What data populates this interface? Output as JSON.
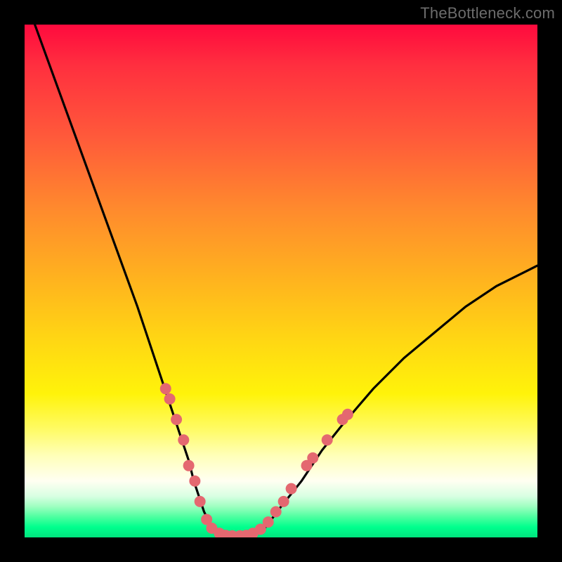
{
  "watermark": "TheBottleneck.com",
  "colors": {
    "background": "#000000",
    "curve": "#000000",
    "marker": "#e46870",
    "gradient_top": "#ff0a3e",
    "gradient_bottom": "#00e47e"
  },
  "chart_data": {
    "type": "line",
    "title": "",
    "xlabel": "",
    "ylabel": "",
    "xlim": [
      0,
      100
    ],
    "ylim": [
      0,
      100
    ],
    "series": [
      {
        "name": "bottleneck-curve",
        "x": [
          2,
          6,
          10,
          14,
          18,
          22,
          24,
          26,
          28,
          30,
          32,
          33,
          34,
          35,
          36,
          37,
          38,
          40,
          42,
          44,
          47,
          50,
          54,
          58,
          62,
          68,
          74,
          80,
          86,
          92,
          98,
          100
        ],
        "y": [
          100,
          89,
          78,
          67,
          56,
          45,
          39,
          33,
          27,
          21,
          15,
          11,
          8,
          5,
          3,
          1.5,
          0.5,
          0,
          0,
          0.5,
          2,
          6,
          11,
          17,
          22,
          29,
          35,
          40,
          45,
          49,
          52,
          53
        ]
      }
    ],
    "markers": [
      {
        "x": 27.5,
        "y": 29
      },
      {
        "x": 28.3,
        "y": 27
      },
      {
        "x": 29.6,
        "y": 23
      },
      {
        "x": 31.0,
        "y": 19
      },
      {
        "x": 32.0,
        "y": 14
      },
      {
        "x": 33.2,
        "y": 11
      },
      {
        "x": 34.2,
        "y": 7
      },
      {
        "x": 35.5,
        "y": 3.5
      },
      {
        "x": 36.5,
        "y": 1.8
      },
      {
        "x": 38.0,
        "y": 0.8
      },
      {
        "x": 39.2,
        "y": 0.4
      },
      {
        "x": 40.5,
        "y": 0.3
      },
      {
        "x": 42.0,
        "y": 0.3
      },
      {
        "x": 43.2,
        "y": 0.4
      },
      {
        "x": 44.5,
        "y": 0.8
      },
      {
        "x": 46.0,
        "y": 1.6
      },
      {
        "x": 47.5,
        "y": 3.0
      },
      {
        "x": 49.0,
        "y": 5.0
      },
      {
        "x": 50.5,
        "y": 7.0
      },
      {
        "x": 52.0,
        "y": 9.5
      },
      {
        "x": 55.0,
        "y": 14
      },
      {
        "x": 56.2,
        "y": 15.5
      },
      {
        "x": 59.0,
        "y": 19
      },
      {
        "x": 62.0,
        "y": 23
      },
      {
        "x": 63.0,
        "y": 24
      }
    ]
  }
}
